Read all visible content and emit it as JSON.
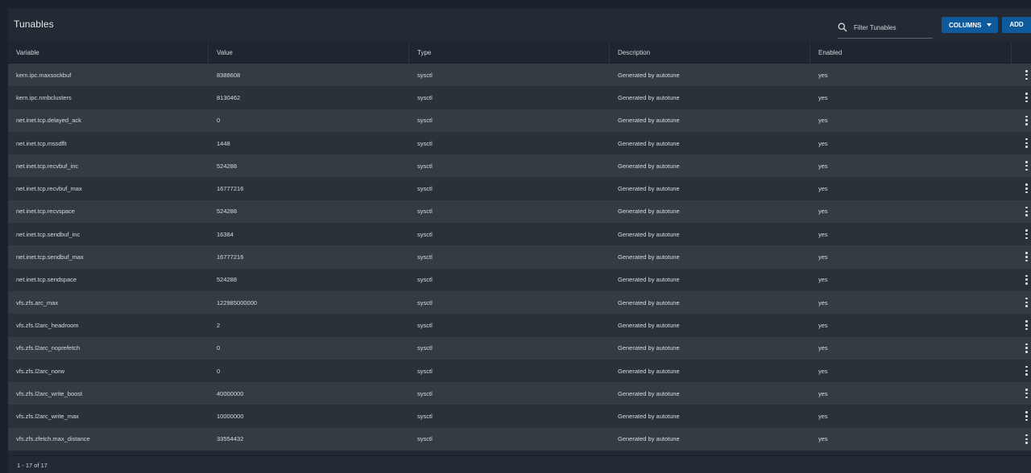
{
  "header": {
    "title": "Tunables",
    "filter_placeholder": "Filter Tunables",
    "columns_label": "COLUMNS",
    "add_label": "ADD"
  },
  "table": {
    "columns": [
      "Variable",
      "Value",
      "Type",
      "Description",
      "Enabled"
    ],
    "rows": [
      {
        "variable": "kern.ipc.maxsockbuf",
        "value": "8388608",
        "type": "sysctl",
        "description": "Generated by autotune",
        "enabled": "yes"
      },
      {
        "variable": "kern.ipc.nmbclusters",
        "value": "8130462",
        "type": "sysctl",
        "description": "Generated by autotune",
        "enabled": "yes"
      },
      {
        "variable": "net.inet.tcp.delayed_ack",
        "value": "0",
        "type": "sysctl",
        "description": "Generated by autotune",
        "enabled": "yes"
      },
      {
        "variable": "net.inet.tcp.mssdflt",
        "value": "1448",
        "type": "sysctl",
        "description": "Generated by autotune",
        "enabled": "yes"
      },
      {
        "variable": "net.inet.tcp.recvbuf_inc",
        "value": "524288",
        "type": "sysctl",
        "description": "Generated by autotune",
        "enabled": "yes"
      },
      {
        "variable": "net.inet.tcp.recvbuf_max",
        "value": "16777216",
        "type": "sysctl",
        "description": "Generated by autotune",
        "enabled": "yes"
      },
      {
        "variable": "net.inet.tcp.recvspace",
        "value": "524288",
        "type": "sysctl",
        "description": "Generated by autotune",
        "enabled": "yes"
      },
      {
        "variable": "net.inet.tcp.sendbuf_inc",
        "value": "16384",
        "type": "sysctl",
        "description": "Generated by autotune",
        "enabled": "yes"
      },
      {
        "variable": "net.inet.tcp.sendbuf_max",
        "value": "16777216",
        "type": "sysctl",
        "description": "Generated by autotune",
        "enabled": "yes"
      },
      {
        "variable": "net.inet.tcp.sendspace",
        "value": "524288",
        "type": "sysctl",
        "description": "Generated by autotune",
        "enabled": "yes"
      },
      {
        "variable": "vfs.zfs.arc_max",
        "value": "122985000000",
        "type": "sysctl",
        "description": "Generated by autotune",
        "enabled": "yes"
      },
      {
        "variable": "vfs.zfs.l2arc_headroom",
        "value": "2",
        "type": "sysctl",
        "description": "Generated by autotune",
        "enabled": "yes"
      },
      {
        "variable": "vfs.zfs.l2arc_noprefetch",
        "value": "0",
        "type": "sysctl",
        "description": "Generated by autotune",
        "enabled": "yes"
      },
      {
        "variable": "vfs.zfs.l2arc_norw",
        "value": "0",
        "type": "sysctl",
        "description": "Generated by autotune",
        "enabled": "yes"
      },
      {
        "variable": "vfs.zfs.l2arc_write_boost",
        "value": "40000000",
        "type": "sysctl",
        "description": "Generated by autotune",
        "enabled": "yes"
      },
      {
        "variable": "vfs.zfs.l2arc_write_max",
        "value": "10000000",
        "type": "sysctl",
        "description": "Generated by autotune",
        "enabled": "yes"
      },
      {
        "variable": "vfs.zfs.zfetch.max_distance",
        "value": "33554432",
        "type": "sysctl",
        "description": "Generated by autotune",
        "enabled": "yes"
      }
    ]
  },
  "footer": {
    "range_text": "1 - 17 of 17"
  },
  "icons": {
    "filter": "search-icon",
    "columns_caret": "chevron-down-icon",
    "row_menu": "more-vert-icon"
  }
}
